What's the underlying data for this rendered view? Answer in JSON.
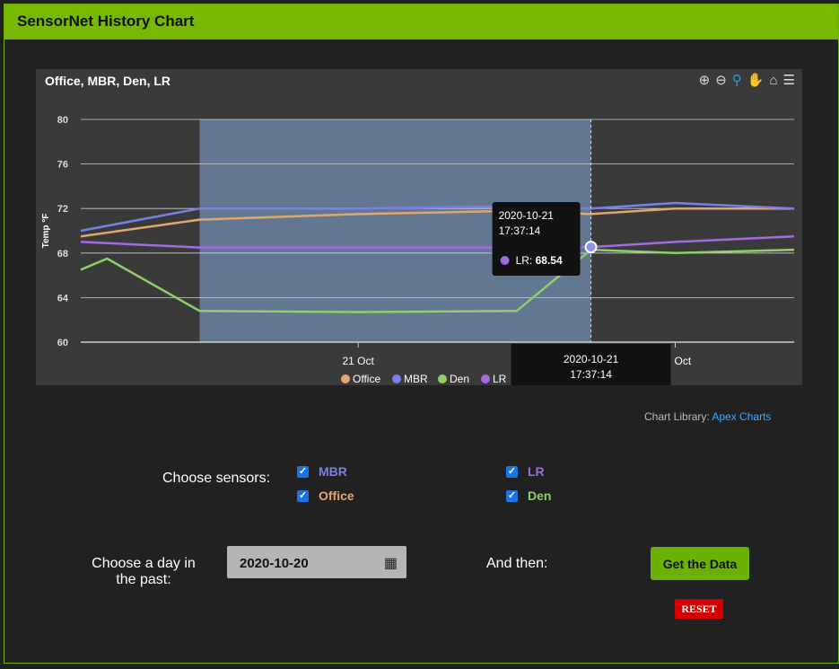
{
  "window": {
    "title": "SensorNet History Chart"
  },
  "chart_header": {
    "title": "Office, MBR, Den, LR",
    "tools": [
      "zoom-in-icon",
      "zoom-out-icon",
      "search-icon",
      "pan-hand-icon",
      "home-icon",
      "menu-icon"
    ]
  },
  "chart_data": {
    "type": "line",
    "title": "Office, MBR, Den, LR",
    "ylabel": "Temp °F",
    "ylim": [
      60,
      80
    ],
    "yticks": [
      "60",
      "64",
      "68",
      "72",
      "76",
      "80"
    ],
    "xticks": [
      "21 Oct",
      "22 Oct"
    ],
    "x_start": "2020-10-20 03:00",
    "x_end": "2020-10-22 09:00",
    "selection": {
      "from": "2020-10-20 12:00",
      "to": "2020-10-21 17:37:14"
    },
    "grid": true,
    "legend_position": "bottom",
    "series": [
      {
        "name": "Office",
        "color": "#e2a76f",
        "x": [
          "2020-10-20 03:00",
          "2020-10-20 12:00",
          "2020-10-21 00:00",
          "2020-10-21 12:00",
          "2020-10-21 17:37",
          "2020-10-22 00:00",
          "2020-10-22 09:00"
        ],
        "y": [
          69.5,
          71.0,
          71.5,
          71.8,
          71.5,
          72.0,
          72.0
        ]
      },
      {
        "name": "MBR",
        "color": "#7b80e8",
        "x": [
          "2020-10-20 03:00",
          "2020-10-20 12:00",
          "2020-10-21 00:00",
          "2020-10-21 12:00",
          "2020-10-21 17:37",
          "2020-10-22 00:00",
          "2020-10-22 09:00"
        ],
        "y": [
          70.0,
          72.0,
          72.0,
          72.2,
          72.0,
          72.5,
          72.0
        ]
      },
      {
        "name": "Den",
        "color": "#8fd06a",
        "x": [
          "2020-10-20 03:00",
          "2020-10-20 05:00",
          "2020-10-20 12:00",
          "2020-10-21 00:00",
          "2020-10-21 12:00",
          "2020-10-21 17:37",
          "2020-10-22 00:00",
          "2020-10-22 09:00"
        ],
        "y": [
          66.5,
          67.5,
          62.8,
          62.7,
          62.8,
          68.3,
          68.0,
          68.3
        ]
      },
      {
        "name": "LR",
        "color": "#a36ae2",
        "x": [
          "2020-10-20 03:00",
          "2020-10-20 12:00",
          "2020-10-21 00:00",
          "2020-10-21 12:00",
          "2020-10-21 17:37",
          "2020-10-22 00:00",
          "2020-10-22 09:00"
        ],
        "y": [
          69.0,
          68.5,
          68.5,
          68.5,
          68.54,
          69.0,
          69.5
        ]
      }
    ],
    "tooltip": {
      "time": "2020-10-21",
      "time2": "17:37:14",
      "series": "LR:",
      "value": "68.54"
    },
    "xaxis_tooltip": {
      "date": "2020-10-21",
      "time": "17:37:14"
    }
  },
  "library_note": {
    "prefix": "Chart Library:",
    "link": "Apex Charts"
  },
  "controls": {
    "choose_sensors_label": "Choose sensors:",
    "sensors": [
      {
        "label": "MBR",
        "checked": true,
        "color": "#7b80e8"
      },
      {
        "label": "Office",
        "checked": true,
        "color": "#e2a76f"
      },
      {
        "label": "LR",
        "checked": true,
        "color": "#a36ae2"
      },
      {
        "label": "Den",
        "checked": true,
        "color": "#8fd06a"
      }
    ],
    "choose_day_label_1": "Choose a day in",
    "choose_day_label_2": "the past:",
    "date_value": "2020-10-20",
    "and_then_label": "And then:",
    "get_data_label": "Get the Data",
    "reset_label": "RESET"
  }
}
